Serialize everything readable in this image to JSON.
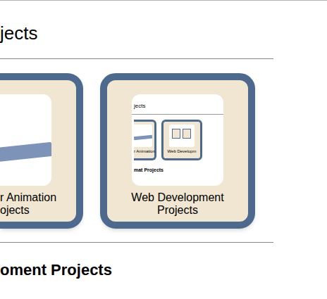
{
  "page": {
    "heading": "jects",
    "subheading": "oment Projects"
  },
  "cards": [
    {
      "kind": "partial",
      "caption_lines": [
        "r Animation",
        "ojects"
      ],
      "thumbnail": {
        "kind": "photo"
      }
    },
    {
      "kind": "full",
      "caption_lines": [
        "Web Development",
        "Projects"
      ],
      "thumbnail": {
        "kind": "page",
        "heading": "jects",
        "cards": [
          {
            "caption": "r Animation"
          },
          {
            "caption": "Web Developm"
          }
        ],
        "footer": "mat Projects"
      }
    }
  ]
}
